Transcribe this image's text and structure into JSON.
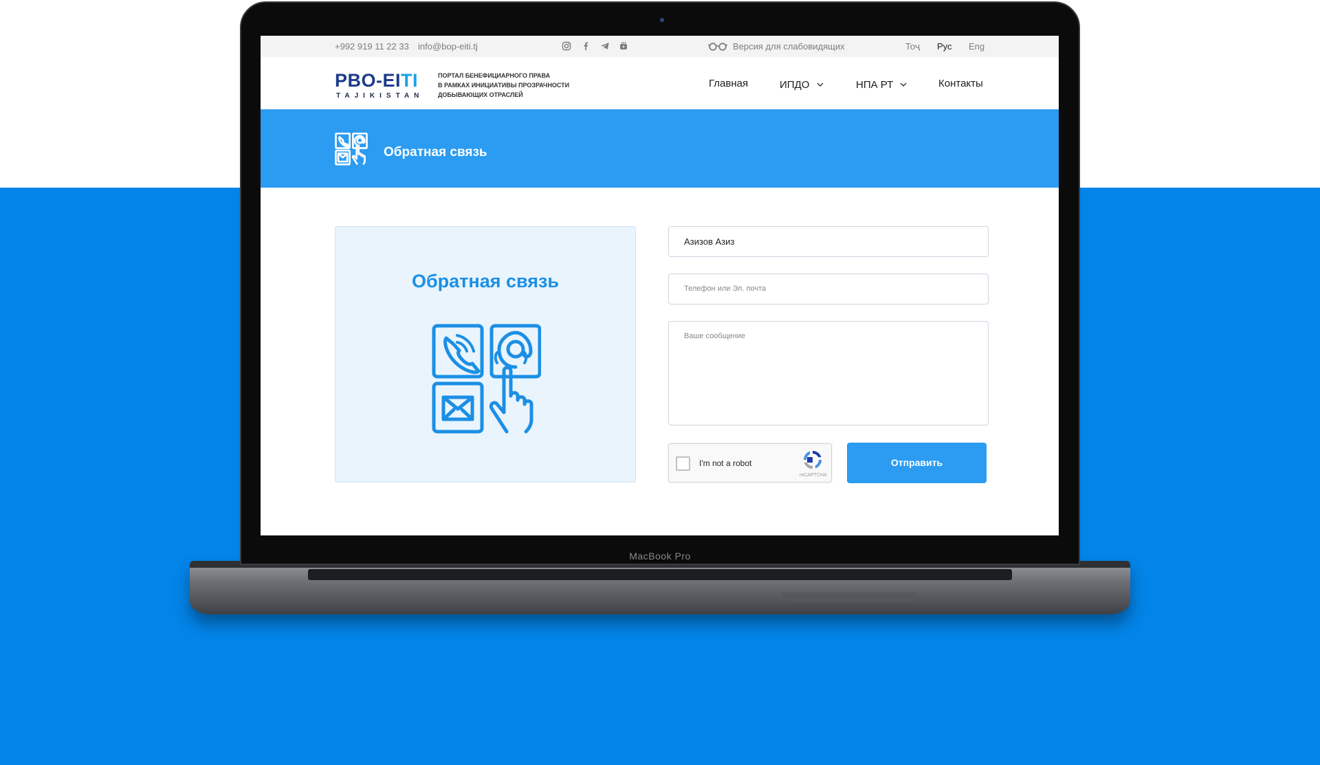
{
  "topbar": {
    "phone": "+992 919 11 22 33",
    "email": "info@bop-eiti.tj",
    "accessibility": "Версия для слабовидящих",
    "languages": [
      "Тоҷ",
      "Рус",
      "Eng"
    ],
    "active_language": "Рус"
  },
  "header": {
    "logo_part1": "PBO-EI",
    "logo_part2": "TI",
    "logo_sub": "TAJIKISTAN",
    "portal_lines": [
      "ПОРТАЛ БЕНЕФИЦИАРНОГО ПРАВА",
      "В РАМКАХ ИНИЦИАТИВЫ ПРОЗРАЧНОСТИ",
      "ДОБЫВАЮЩИХ ОТРАСЛЕЙ"
    ],
    "nav": [
      "Главная",
      "ИПДО",
      "НПА РТ",
      "Контакты"
    ]
  },
  "banner": {
    "title": "Обратная связь"
  },
  "card": {
    "title": "Обратная связь"
  },
  "form": {
    "name_value": "Азизов Азиз",
    "contact_placeholder": "Телефон или Эл. почта",
    "message_placeholder": "Ваше сообщение",
    "captcha_label": "I'm not a robot",
    "captcha_brand": "reCAPTCHA",
    "submit_label": "Отправить"
  },
  "device": {
    "brand": "MacBook Pro"
  },
  "colors": {
    "accent": "#2b9cf1",
    "background_blue": "#0384e8",
    "logo_dark": "#1d3a8a",
    "logo_light": "#1aa0e8"
  }
}
